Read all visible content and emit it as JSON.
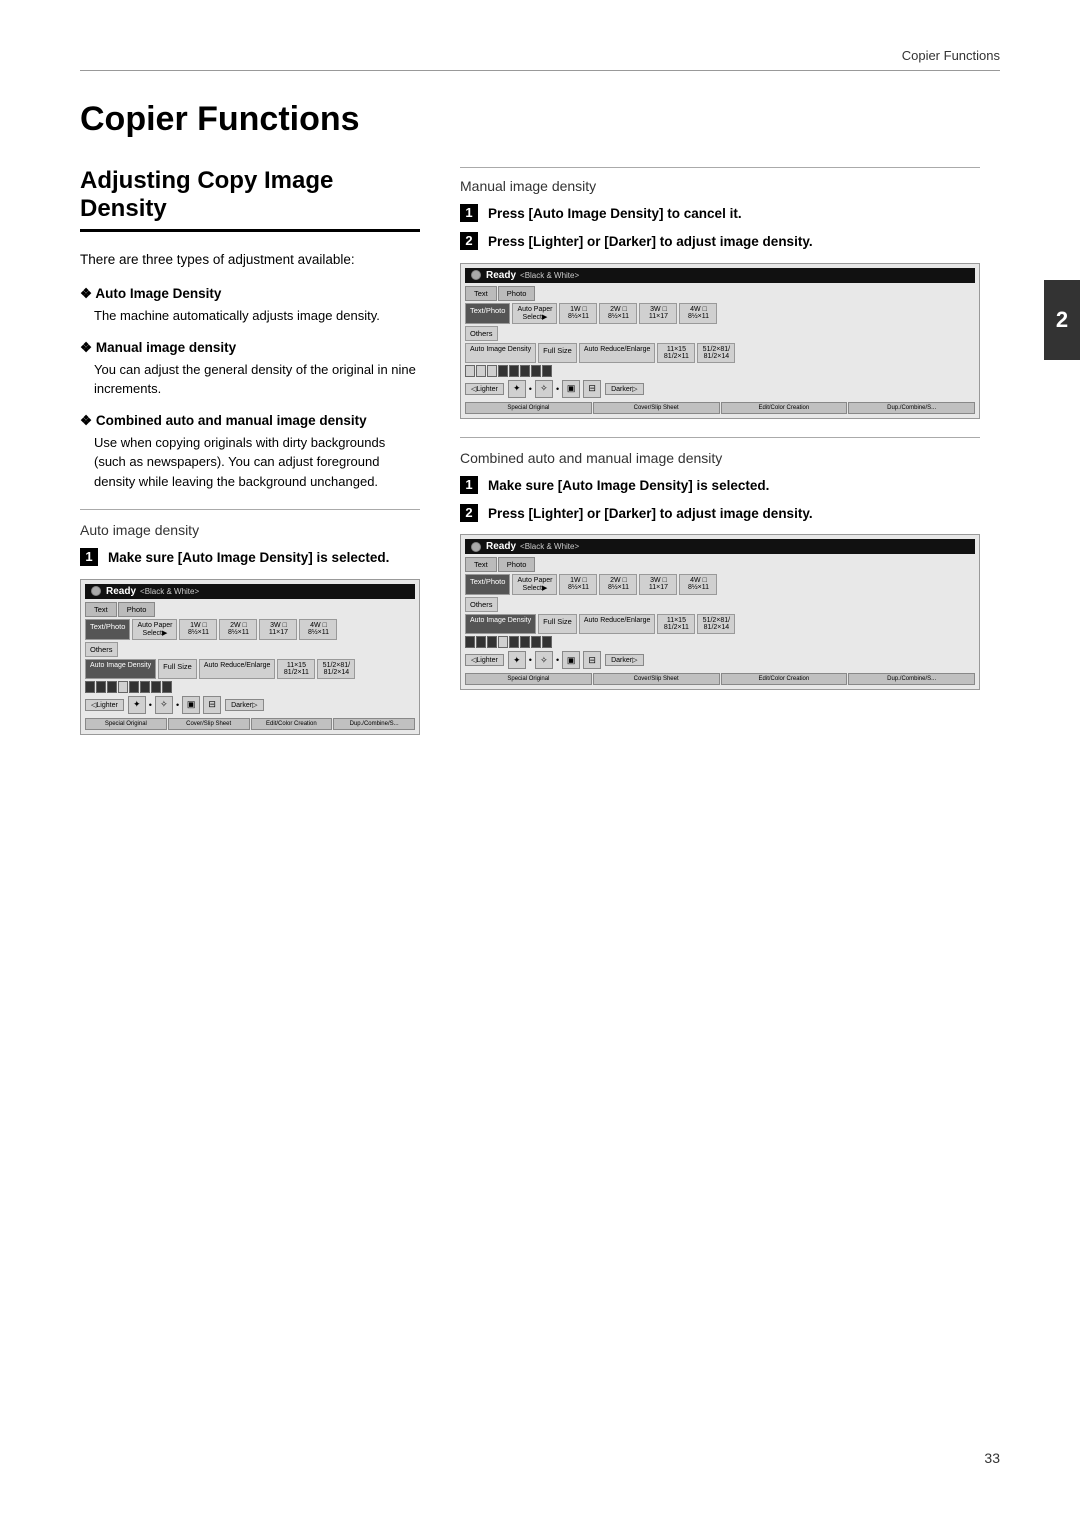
{
  "header": {
    "section_label": "Copier Functions"
  },
  "page_number": "33",
  "chapter_number": "2",
  "page_title": "Copier Functions",
  "section_title": "Adjusting Copy Image Density",
  "intro_text": "There are three types of adjustment available:",
  "bullets": [
    {
      "id": "auto",
      "header": "Auto Image Density",
      "body": "The machine automatically adjusts image density."
    },
    {
      "id": "manual",
      "header": "Manual image density",
      "body": "You can adjust the general density of the original in nine increments."
    },
    {
      "id": "combined",
      "header": "Combined auto and manual image density",
      "body": "Use when copying originals with dirty backgrounds (such as newspapers). You can adjust foreground density while leaving the background unchanged."
    }
  ],
  "auto_density_section": {
    "label": "Auto image density",
    "step1": {
      "num": "1",
      "text": "Make sure [Auto Image Density] is selected."
    }
  },
  "manual_density_section": {
    "label": "Manual image density",
    "step1": {
      "num": "1",
      "text": "Press [Auto Image Density] to cancel it."
    },
    "step2": {
      "num": "2",
      "text": "Press [Lighter] or [Darker] to adjust image density."
    }
  },
  "combined_section": {
    "label": "Combined auto and manual image density",
    "step1": {
      "num": "1",
      "text": "Make sure [Auto Image Density] is selected."
    },
    "step2": {
      "num": "2",
      "text": "Press [Lighter] or [Darker] to adjust image density."
    }
  },
  "machine_ui": {
    "ready_label": "Ready",
    "sub_label": "<Black & White>",
    "tab1": "Text",
    "tab2": "Photo",
    "tab_text_photo": "Text/Photo",
    "tab_others": "Others",
    "auto_image_density": "Auto Image Density",
    "full_size": "Full Size",
    "auto_reduce_enlarge": "Auto Reduce/Enlarge",
    "paper_select": "Auto Paper Select▶",
    "size_1": "1W □ 85×11",
    "size_2": "2W □ 85×11",
    "size_3": "3W □ 11×17",
    "size_4": "4W □ 85×11",
    "size_11x15": "11×15 / 81/2×11",
    "size_512x81": "51/2×81/2×14",
    "lighter": "◁Lighter",
    "darker": "Darker▷",
    "special_original": "Special Original",
    "cover_slip_sheet": "Cover/Slip Sheet",
    "edit_color_creation": "Edit/Color Creation",
    "dup_combine": "Dup./Combine/S..."
  }
}
